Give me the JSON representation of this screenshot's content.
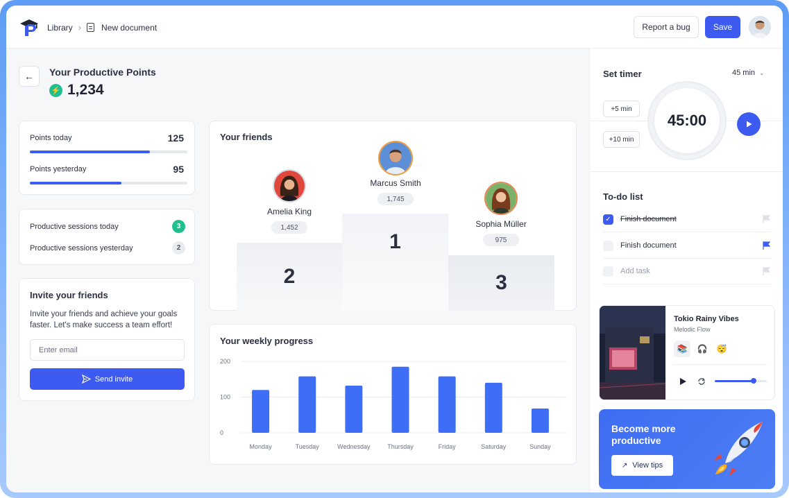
{
  "breadcrumb": {
    "root": "Library",
    "current": "New document"
  },
  "header": {
    "report_bug": "Report a bug",
    "save": "Save"
  },
  "points": {
    "title": "Your Productive Points",
    "total": "1,234"
  },
  "stats": {
    "today_label": "Points today",
    "today_value": "125",
    "today_fraction": 0.76,
    "yesterday_label": "Points yesterday",
    "yesterday_value": "95",
    "yesterday_fraction": 0.58
  },
  "sessions": {
    "today_label": "Productive sessions today",
    "today_count": "3",
    "yesterday_label": "Productive sessions yesterday",
    "yesterday_count": "2"
  },
  "invite": {
    "title": "Invite your friends",
    "text": "Invite your friends and achieve your goals faster. Let's make success a team effort!",
    "placeholder": "Enter email",
    "button": "Send invite"
  },
  "friends": {
    "title": "Your friends",
    "first": {
      "name": "Marcus Smith",
      "points": "1,745",
      "rank": "1"
    },
    "second": {
      "name": "Amelia King",
      "points": "1,452",
      "rank": "2"
    },
    "third": {
      "name": "Sophia Müller",
      "points": "975",
      "rank": "3"
    }
  },
  "weekly": {
    "title": "Your weekly progress"
  },
  "chart_data": {
    "type": "bar",
    "categories": [
      "Monday",
      "Tuesday",
      "Wednesday",
      "Thursday",
      "Friday",
      "Saturday",
      "Sunday"
    ],
    "values": [
      120,
      158,
      132,
      185,
      158,
      140,
      68
    ],
    "yticks": [
      "200",
      "100",
      "0"
    ],
    "ylim": [
      0,
      200
    ],
    "color": "#3d6ef5"
  },
  "timer": {
    "title": "Set timer",
    "duration": "45 min",
    "plus5": "+5 min",
    "plus10": "+10 min",
    "display": "45:00"
  },
  "todo": {
    "title": "To-do list",
    "items": [
      {
        "label": "Finish document",
        "done": true
      },
      {
        "label": "Finish document",
        "done": false
      }
    ],
    "add": "Add task"
  },
  "music": {
    "title": "Tokio Rainy Vibes",
    "artist": "Melodic Flow",
    "progress": 0.75
  },
  "promo": {
    "line1": "Become more",
    "line2": "productive",
    "button": "View tips"
  },
  "colors": {
    "accent": "#3d5af1",
    "success": "#1fbf8f"
  }
}
